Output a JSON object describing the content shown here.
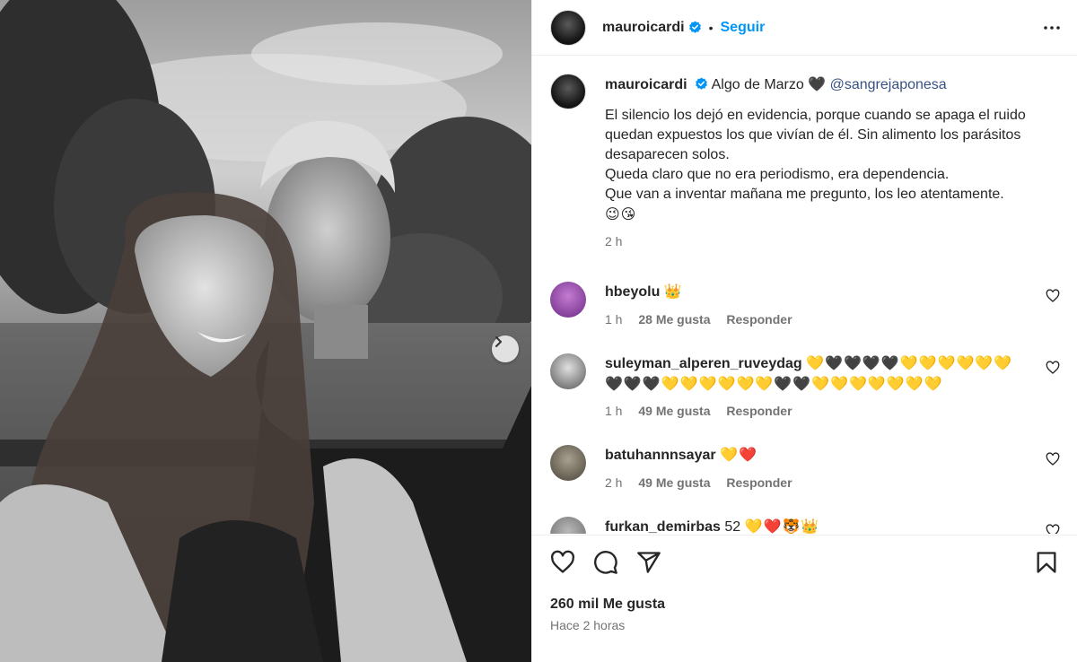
{
  "post": {
    "username": "mauroicardi",
    "follow_label": "Seguir",
    "dot": "•",
    "caption_title": "Algo de Marzo 🖤",
    "mention": "@sangrejaponesa",
    "caption_text": "El silencio los dejó en evidencia, porque cuando se apaga el ruido quedan expuestos los que vivían de él. Sin alimento los parásitos desaparecen solos.\nQueda claro que no era periodismo, era dependencia.\nQue van a inventar mañana me pregunto, los leo atentamente.",
    "caption_emoji": "😉😘",
    "caption_time": "2 h",
    "likes": "260 mil Me gusta",
    "posted_ago": "Hace 2 horas"
  },
  "comments": [
    {
      "username": "hbeyolu",
      "emoji": "👑",
      "time": "1 h",
      "likes": "28 Me gusta",
      "reply": "Responder"
    },
    {
      "username": "suleyman_alperen_ruveydag",
      "emoji_line1": "💛🖤🖤🖤🖤💛💛💛💛💛💛",
      "emoji_line2": "🖤🖤🖤💛💛💛💛💛💛🖤🖤💛💛💛💛💛💛💛",
      "time": "1 h",
      "likes": "49 Me gusta",
      "reply": "Responder"
    },
    {
      "username": "batuhannnsayar",
      "emoji": "💛❤️",
      "time": "2 h",
      "likes": "49 Me gusta",
      "reply": "Responder"
    },
    {
      "username": "furkan_demirbas",
      "text": "52",
      "emoji": "💛❤️🐯👑"
    }
  ],
  "icons": {
    "more": "more-options-icon",
    "like": "heart-icon",
    "comment": "comment-icon",
    "share": "share-icon",
    "save": "bookmark-icon",
    "next": "chevron-right-icon",
    "verified": "verified-badge-icon"
  },
  "colors": {
    "accent": "#0095f6",
    "mention": "#385185",
    "verified": "#0095f6",
    "muted": "#737373",
    "heart_yellow": "#f0c800",
    "heart_red": "#e0242c"
  }
}
